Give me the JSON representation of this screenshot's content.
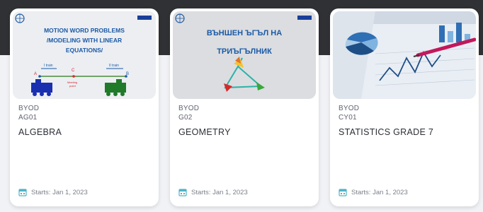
{
  "colors": {
    "card_bg": "#ffffff",
    "page_bg": "#f1f2f5",
    "top_band": "#2f3135",
    "calendar_icon": "#4fb3c8",
    "thumb_text": "#1a5aa6"
  },
  "cards": [
    {
      "thumb_title": [
        "MOTION WORD PROBLEMS",
        "/MODELING WITH LINEAR",
        "EQUATIONS/"
      ],
      "thumb_labels": [
        "I train",
        "II train",
        "A",
        "C",
        "B",
        "Meeting",
        "point"
      ],
      "program": "BYOD",
      "code": "AG01",
      "title": "ALGEBRA",
      "starts": "Starts: Jan 1, 2023",
      "icon": "calendar-icon"
    },
    {
      "thumb_title": [
        "ВЪНШЕН ЪГЪЛ НА",
        "ТРИЪГЪЛНИК"
      ],
      "program": "BYOD",
      "code": "G02",
      "title": "GEOMETRY",
      "starts": "Starts: Jan 1, 2023",
      "icon": "calendar-icon"
    },
    {
      "program": "BYOD",
      "code": "CY01",
      "title": "STATISTICS GRADE 7",
      "starts": "Starts: Jan 1, 2023",
      "icon": "calendar-icon"
    }
  ]
}
